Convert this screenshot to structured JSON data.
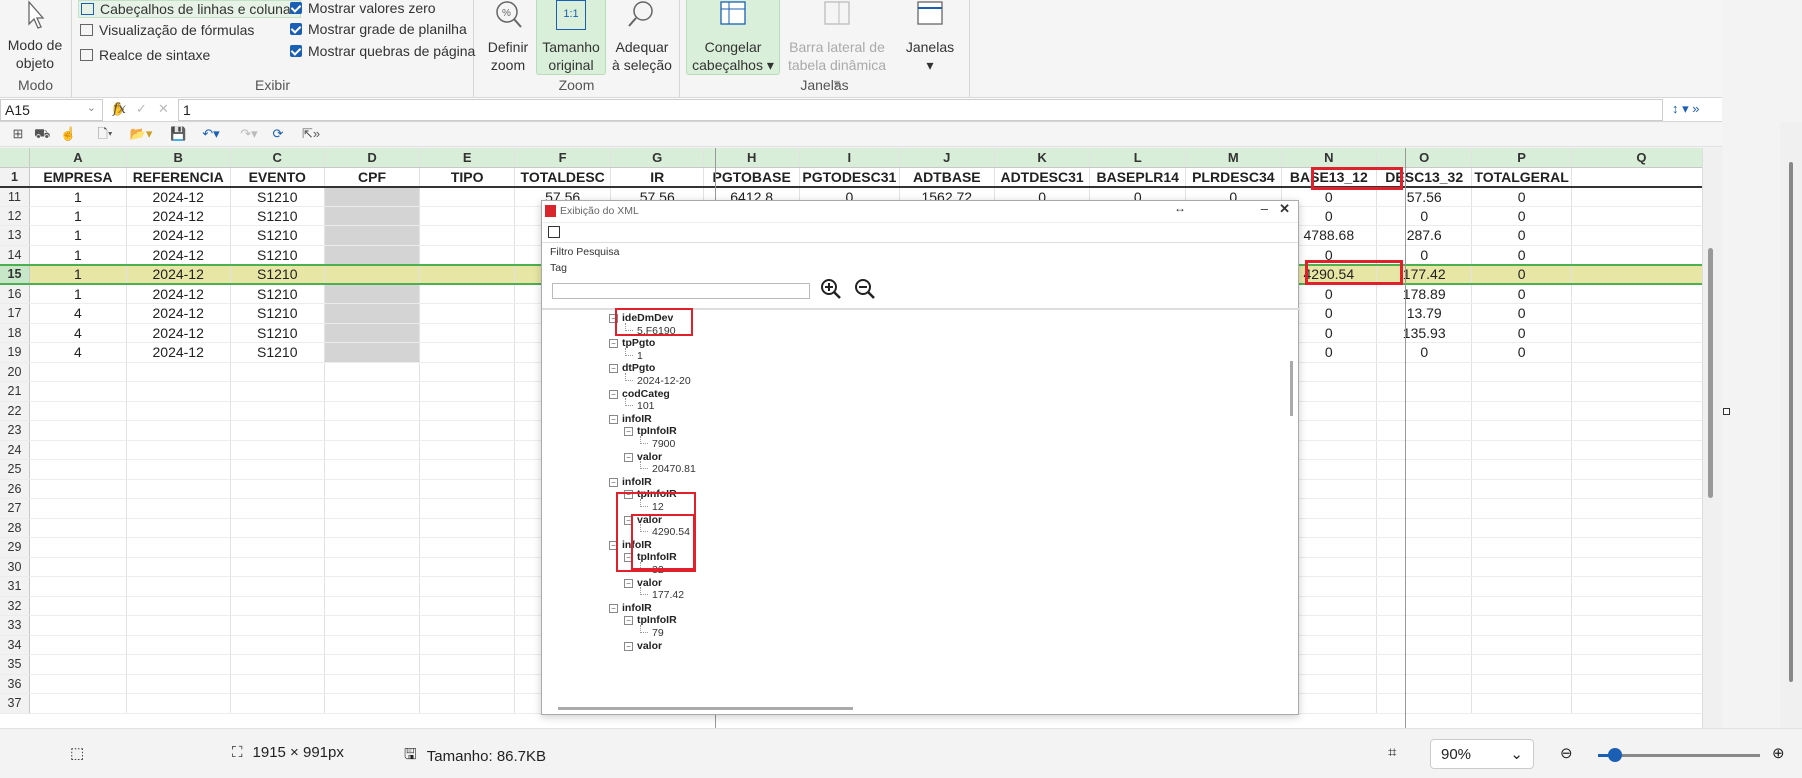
{
  "ribbon": {
    "modo": {
      "btn": "Modo de objeto",
      "label": "Modo"
    },
    "exibir": {
      "label": "Exibir",
      "opts": [
        "Cabeçalhos de linhas e colunas",
        "Visualização de fórmulas",
        "Realce de sintaxe"
      ],
      "checks": [
        "Mostrar valores zero",
        "Mostrar grade de planilha",
        "Mostrar quebras de página"
      ]
    },
    "zoom": {
      "label": "Zoom",
      "definir": "Definir zoom",
      "tamanho": "Tamanho original",
      "tamanho_ico": "1:1",
      "adequar": "Adequar à seleção"
    },
    "janelas": {
      "label": "Janelas",
      "congelar": "Congelar cabeçalhos",
      "barra": "Barra lateral de tabela dinâmica",
      "janelas": "Janelas"
    }
  },
  "formula": {
    "cell": "A15",
    "fx": "fx",
    "value": "1"
  },
  "sheet": {
    "columns": [
      "A",
      "B",
      "C",
      "D",
      "E",
      "F",
      "G",
      "H",
      "I",
      "J",
      "K",
      "L",
      "M",
      "N",
      "O",
      "P",
      "Q"
    ],
    "header_row": "1",
    "headers": [
      "EMPRESA",
      "REFERENCIA",
      "EVENTO",
      "CPF",
      "TIPO",
      "TOTALDESC",
      "IR",
      "PGTOBASE",
      "PGTODESC31",
      "ADTBASE",
      "ADTDESC31",
      "BASEPLR14",
      "PLRDESC34",
      "BASE13_12",
      "DESC13_32",
      "TOTALGERAL",
      ""
    ],
    "rows": [
      {
        "n": "11",
        "a": "1",
        "b": "2024-12",
        "c": "S1210",
        "f": "57.56",
        "g": "57.56",
        "h": "6412.8",
        "i": "0",
        "j": "1562.72",
        "k": "0",
        "l": "0",
        "m": "0",
        "nn": "0",
        "o": "57.56",
        "p": "0"
      },
      {
        "n": "12",
        "a": "1",
        "b": "2024-12",
        "c": "S1210",
        "nn": "0",
        "o": "0",
        "p": "0"
      },
      {
        "n": "13",
        "a": "1",
        "b": "2024-12",
        "c": "S1210",
        "nn": "4788.68",
        "o": "287.6",
        "p": "0"
      },
      {
        "n": "14",
        "a": "1",
        "b": "2024-12",
        "c": "S1210",
        "nn": "0",
        "o": "0",
        "p": "0"
      },
      {
        "n": "15",
        "a": "1",
        "b": "2024-12",
        "c": "S1210",
        "nn": "4290.54",
        "o": "177.42",
        "p": "0"
      },
      {
        "n": "16",
        "a": "1",
        "b": "2024-12",
        "c": "S1210",
        "nn": "0",
        "o": "178.89",
        "p": "0"
      },
      {
        "n": "17",
        "a": "4",
        "b": "2024-12",
        "c": "S1210",
        "nn": "0",
        "o": "13.79",
        "p": "0"
      },
      {
        "n": "18",
        "a": "4",
        "b": "2024-12",
        "c": "S1210",
        "nn": "0",
        "o": "135.93",
        "p": "0"
      },
      {
        "n": "19",
        "a": "4",
        "b": "2024-12",
        "c": "S1210",
        "nn": "0",
        "o": "0",
        "p": "0"
      }
    ],
    "empty_rows": [
      "20",
      "21",
      "22",
      "23",
      "24",
      "25",
      "26",
      "27",
      "28",
      "29",
      "30",
      "31",
      "32",
      "33",
      "34",
      "35",
      "36",
      "37"
    ]
  },
  "dialog": {
    "title": "Exibição do XML",
    "filter": "Filtro Pesquisa",
    "tag": "Tag",
    "tree": [
      {
        "t": "ideDmDev",
        "d": 0,
        "b": true
      },
      {
        "t": "5.F6190",
        "d": 1
      },
      {
        "t": "tpPgto",
        "d": 0,
        "b": true
      },
      {
        "t": "1",
        "d": 1
      },
      {
        "t": "dtPgto",
        "d": 0,
        "b": true
      },
      {
        "t": "2024-12-20",
        "d": 1
      },
      {
        "t": "codCateg",
        "d": 0,
        "b": true
      },
      {
        "t": "101",
        "d": 1
      },
      {
        "t": "infoIR",
        "d": 0,
        "b": true
      },
      {
        "t": "tpInfoIR",
        "d": 1,
        "b": true
      },
      {
        "t": "7900",
        "d": 2
      },
      {
        "t": "valor",
        "d": 1,
        "b": true
      },
      {
        "t": "20470.81",
        "d": 2
      },
      {
        "t": "infoIR",
        "d": 0,
        "b": true
      },
      {
        "t": "tpInfoIR",
        "d": 1,
        "b": true
      },
      {
        "t": "12",
        "d": 2
      },
      {
        "t": "valor",
        "d": 1,
        "b": true
      },
      {
        "t": "4290.54",
        "d": 2
      },
      {
        "t": "infoIR",
        "d": 0,
        "b": true
      },
      {
        "t": "tpInfoIR",
        "d": 1,
        "b": true
      },
      {
        "t": "32",
        "d": 2
      },
      {
        "t": "valor",
        "d": 1,
        "b": true
      },
      {
        "t": "177.42",
        "d": 2
      },
      {
        "t": "infoIR",
        "d": 0,
        "b": true
      },
      {
        "t": "tpInfoIR",
        "d": 1,
        "b": true
      },
      {
        "t": "79",
        "d": 2
      },
      {
        "t": "valor",
        "d": 1,
        "b": true
      }
    ]
  },
  "status": {
    "dims": "1915 × 991px",
    "size": "Tamanho: 86.7KB",
    "zoom": "90%"
  }
}
